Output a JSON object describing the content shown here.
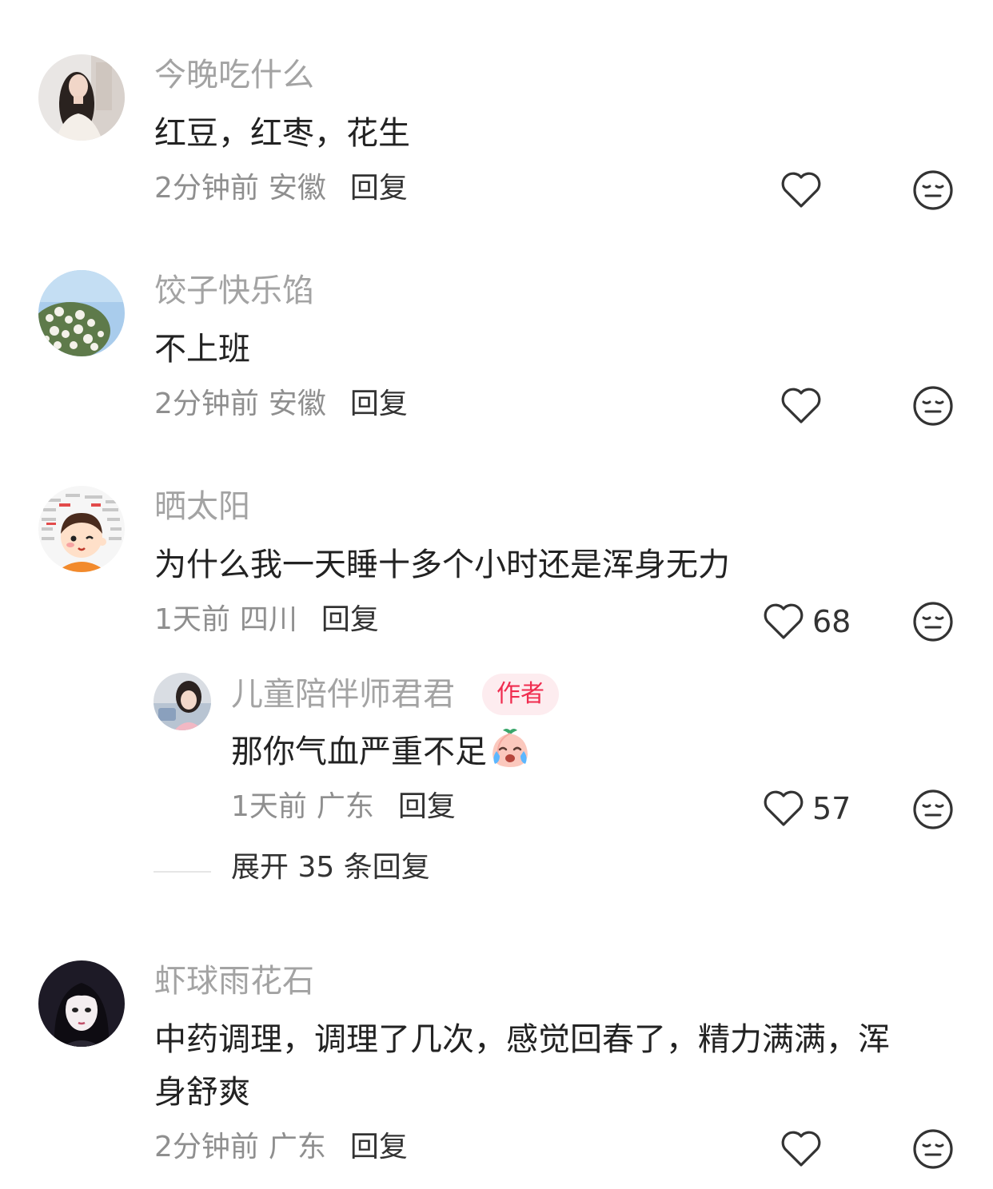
{
  "comments": [
    {
      "username": "今晚吃什么",
      "content": "红豆，红枣，花生",
      "time": "2分钟前",
      "location": "安徽",
      "reply_label": "回复",
      "like_count": "",
      "avatar_icon": "woman-portrait-avatar"
    },
    {
      "username": "饺子快乐馅",
      "content": "不上班",
      "time": "2分钟前",
      "location": "安徽",
      "reply_label": "回复",
      "like_count": "",
      "avatar_icon": "flowering-tree-avatar"
    },
    {
      "username": "晒太阳",
      "content": "为什么我一天睡十多个小时还是浑身无力",
      "time": "1天前",
      "location": "四川",
      "reply_label": "回复",
      "like_count": "68",
      "avatar_icon": "cartoon-boy-avatar",
      "sub_reply": {
        "username": "儿童陪伴师君君",
        "badge": "作者",
        "content": "那你气血严重不足",
        "content_emoji": "crying-peach-emoji",
        "time": "1天前",
        "location": "广东",
        "reply_label": "回复",
        "like_count": "57",
        "avatar_icon": "girl-photo-avatar"
      },
      "expand_label": "展开 35 条回复"
    },
    {
      "username": "虾球雨花石",
      "content_line1": "中药调理，调理了几次，感觉回春了，精力满满，浑",
      "content_line2": "身舒爽",
      "time": "2分钟前",
      "location": "广东",
      "reply_label": "回复",
      "like_count": "",
      "avatar_icon": "anime-girl-avatar"
    }
  ],
  "colors": {
    "username": "#a3a3a3",
    "content": "#222222",
    "meta": "#8f8f8f",
    "badge_bg": "#fdecef",
    "badge_text": "#f02c4f"
  },
  "icons": {
    "like": "heart-outline-icon",
    "dislike": "neutral-face-icon"
  }
}
